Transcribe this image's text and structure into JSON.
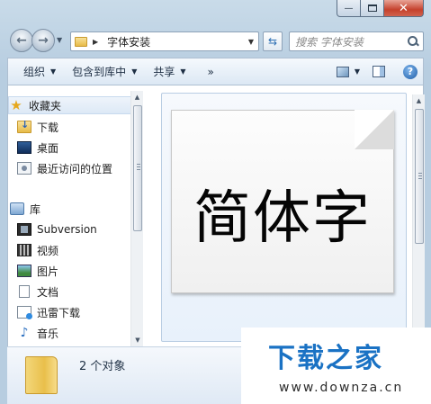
{
  "window": {
    "caption": {
      "minimize": "—",
      "close": "✕"
    }
  },
  "address_bar": {
    "path": "字体安装",
    "search_placeholder": "搜索 字体安装"
  },
  "toolbar": {
    "organize": "组织",
    "include_in_library": "包含到库中",
    "share": "共享",
    "more": "»",
    "help": "?"
  },
  "sidebar": {
    "favorites": [
      {
        "label": "收藏夹",
        "icon": "star-icon"
      },
      {
        "label": "下载",
        "icon": "download-folder-icon"
      },
      {
        "label": "桌面",
        "icon": "desktop-icon"
      },
      {
        "label": "最近访问的位置",
        "icon": "recent-places-icon"
      }
    ],
    "libraries": [
      {
        "label": "库",
        "icon": "library-icon"
      },
      {
        "label": "Subversion",
        "icon": "subversion-icon"
      },
      {
        "label": "视频",
        "icon": "video-icon"
      },
      {
        "label": "图片",
        "icon": "pictures-icon"
      },
      {
        "label": "文档",
        "icon": "documents-icon"
      },
      {
        "label": "迅雷下载",
        "icon": "xunlei-icon"
      },
      {
        "label": "音乐",
        "icon": "music-icon"
      }
    ]
  },
  "content": {
    "font_preview_text": "简体字"
  },
  "details": {
    "item_count": "2 个对象"
  },
  "watermark": {
    "title": "下载之家",
    "url": "www.downza.cn"
  },
  "colors": {
    "accent": "#1a72c4",
    "frame": "#b7cde0",
    "close_button": "#c5412c"
  }
}
